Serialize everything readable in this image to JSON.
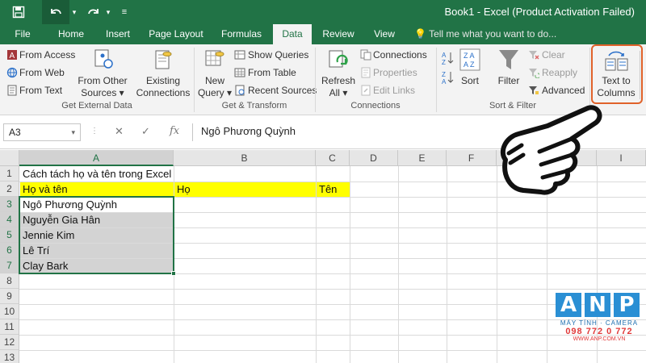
{
  "window": {
    "title": "Book1 - Excel (Product Activation Failed)",
    "quick_access": [
      {
        "name": "save-icon",
        "glyph": "💾"
      },
      {
        "name": "undo-icon",
        "glyph": "↶"
      },
      {
        "name": "redo-icon",
        "glyph": "↷"
      },
      {
        "name": "customize-icon",
        "glyph": "▾"
      }
    ]
  },
  "tabs": [
    "File",
    "Home",
    "Insert",
    "Page Layout",
    "Formulas",
    "Data",
    "Review",
    "View"
  ],
  "active_tab": "Data",
  "tell_me": "Tell me what you want to do...",
  "ribbon": {
    "get_external": {
      "from_access": "From Access",
      "from_web": "From Web",
      "from_text": "From Text",
      "from_other_1": "From Other",
      "from_other_2": "Sources",
      "existing_1": "Existing",
      "existing_2": "Connections",
      "label": "Get External Data"
    },
    "get_transform": {
      "new_query_1": "New",
      "new_query_2": "Query",
      "show_queries": "Show Queries",
      "from_table": "From Table",
      "recent_sources": "Recent Sources",
      "label": "Get & Transform"
    },
    "connections": {
      "refresh_1": "Refresh",
      "refresh_2": "All",
      "connections": "Connections",
      "properties": "Properties",
      "edit_links": "Edit Links",
      "label": "Connections"
    },
    "sort_filter": {
      "sort": "Sort",
      "filter": "Filter",
      "clear": "Clear",
      "reapply": "Reapply",
      "advanced": "Advanced",
      "label": "Sort & Filter"
    },
    "data_tools": {
      "text_to_1": "Text to",
      "text_to_2": "Columns"
    }
  },
  "formula_bar": {
    "name_box": "A3",
    "fx": "fx",
    "value": "Ngô Phương Quỳnh"
  },
  "columns": [
    "A",
    "B",
    "C",
    "D",
    "E",
    "F",
    "G",
    "H",
    "I"
  ],
  "rows": [
    "1",
    "2",
    "3",
    "4",
    "5",
    "6",
    "7",
    "8",
    "9",
    "10",
    "11",
    "12",
    "13"
  ],
  "cells": {
    "a1": "Cách tách họ và tên trong Excel",
    "a2": "Họ và tên",
    "b2": "Họ",
    "c2": "Tên",
    "a3": "Ngô Phương Quỳnh",
    "a4": "Nguyễn Gia Hân",
    "a5": "Jennie Kim",
    "a6": "Lê Trí",
    "a7": "Clay Bark"
  },
  "colors": {
    "excel_green": "#217346",
    "highlight_yellow": "#ffff00",
    "selection_gray": "#d3d3d3",
    "callout_orange": "#e0622a",
    "logo_blue": "#2a8fd4",
    "logo_red": "#e03a3a"
  },
  "logo": {
    "letters": [
      "A",
      "N",
      "P"
    ],
    "sub": "MÁY TÍNH · CAMERA",
    "phone": "098 772 0 772",
    "web": "WWW.ANP.COM.VN"
  }
}
